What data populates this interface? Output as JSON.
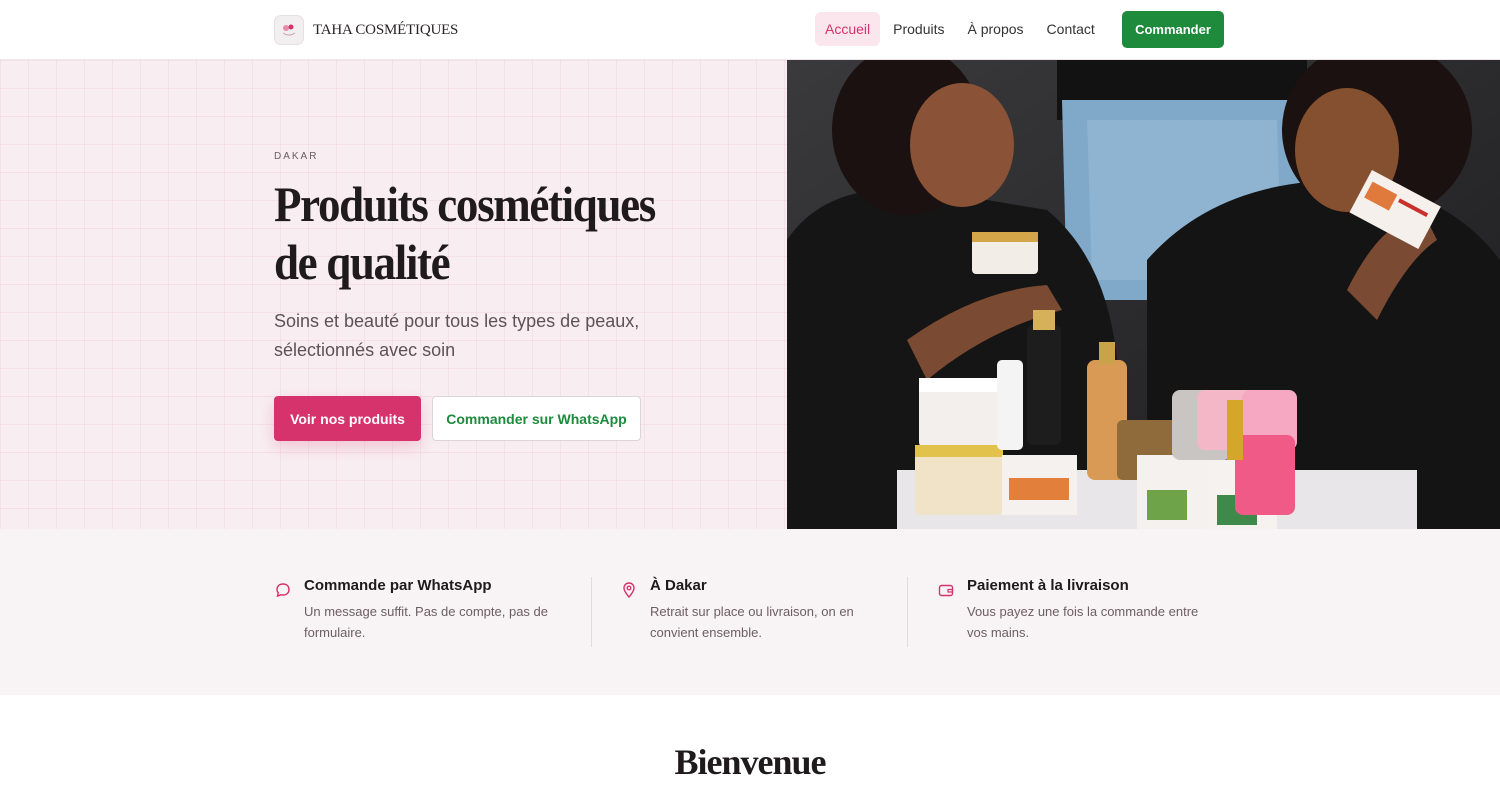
{
  "nav": {
    "brand_name": "TAHA COSMÉTIQUES",
    "links": [
      {
        "label": "Accueil",
        "active": true
      },
      {
        "label": "Produits",
        "active": false
      },
      {
        "label": "À propos",
        "active": false
      },
      {
        "label": "Contact",
        "active": false
      }
    ],
    "order_label": "Commander"
  },
  "hero": {
    "eyebrow": "DAKAR",
    "title_line1": "Produits cosmétiques",
    "title_line2": "de qualité",
    "subtitle": "Soins et beauté pour tous les types de peaux, sélectionnés avec soin",
    "primary_cta": "Voir nos produits",
    "secondary_cta": "Commander sur WhatsApp",
    "image_icon": "hero-photo"
  },
  "features": [
    {
      "icon": "chat-bubble-icon",
      "title": "Commande par WhatsApp",
      "description": "Un message suffit. Pas de compte, pas de formulaire."
    },
    {
      "icon": "map-pin-icon",
      "title": "À Dakar",
      "description": "Retrait sur place ou livraison, on en convient ensemble."
    },
    {
      "icon": "wallet-icon",
      "title": "Paiement à la livraison",
      "description": "Vous payez une fois la commande entre vos mains."
    }
  ],
  "welcome": {
    "title": "Bienvenue"
  },
  "colors": {
    "accent": "#d6336c",
    "whatsapp_green": "#1e8a3c",
    "hero_bg": "#f8eef1",
    "features_bg": "#f8f3f5"
  }
}
